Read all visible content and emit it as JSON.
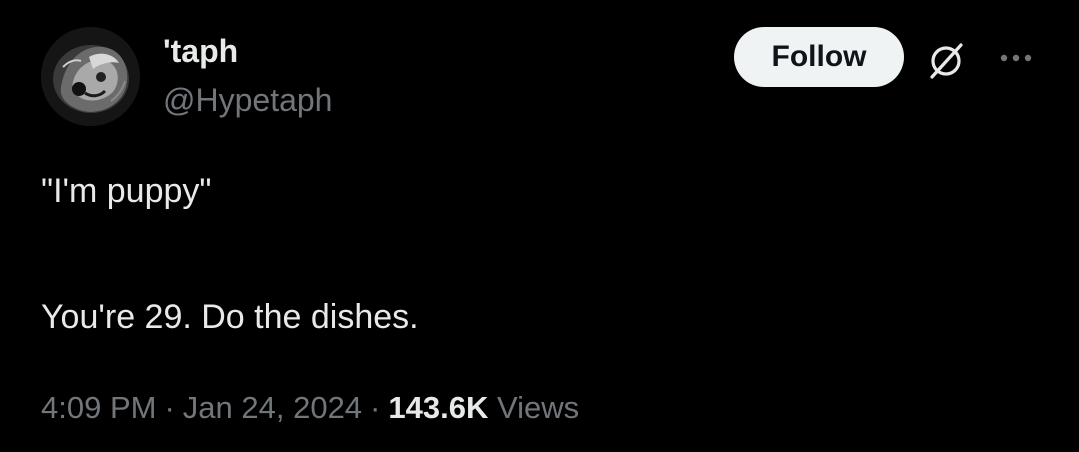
{
  "author": {
    "display_name": "'taph",
    "handle": "@Hypetaph"
  },
  "actions": {
    "follow_label": "Follow",
    "grok_icon": "grok-slash-circle-icon",
    "more_icon": "ellipsis-icon"
  },
  "tweet": {
    "paragraphs": [
      "\"I'm puppy\"",
      "You're 29. Do the dishes."
    ]
  },
  "meta": {
    "time": "4:09 PM",
    "separator": "·",
    "date": "Jan 24, 2024",
    "views_count": "143.6K",
    "views_label": "Views"
  },
  "colors": {
    "background": "#000000",
    "primary_text": "#e7e9ea",
    "secondary_text": "#71767b",
    "follow_button_bg": "#eff3f4",
    "follow_button_text": "#0f1419"
  }
}
